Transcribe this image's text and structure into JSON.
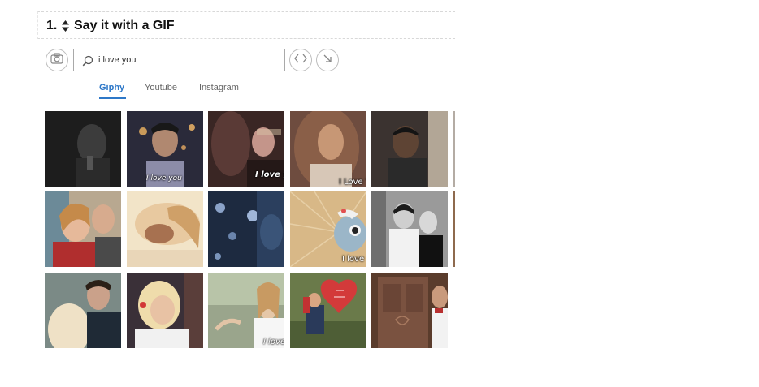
{
  "question": {
    "number": "1.",
    "title": "Say it with a GIF"
  },
  "search": {
    "value": "i love you"
  },
  "tabs": [
    {
      "label": "Giphy",
      "active": true
    },
    {
      "label": "Youtube",
      "active": false
    },
    {
      "label": "Instagram",
      "active": false
    }
  ],
  "icons": {
    "sort": "sort-arrows-icon",
    "camera": "camera-icon",
    "search": "search-icon",
    "embed": "embed-code-icon",
    "insert": "arrow-down-right-icon"
  },
  "colors": {
    "accent": "#2e78c8"
  },
  "gifs": {
    "r1c2": "I love you",
    "r1c3": "I love y",
    "r1c4": "I Love Y",
    "r2c4": "I love",
    "r3c3": "I love"
  }
}
